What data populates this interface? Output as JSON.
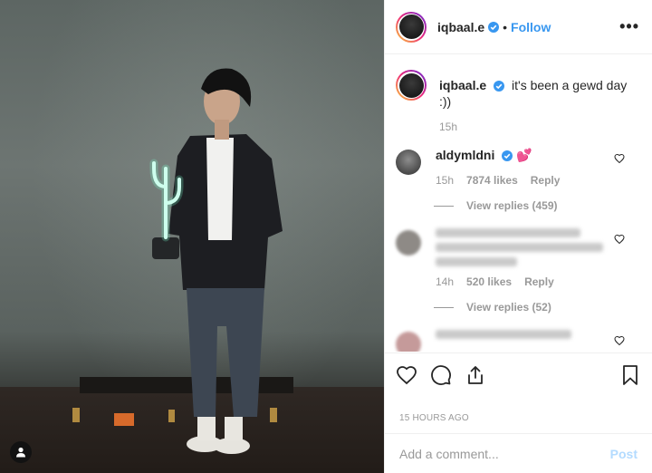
{
  "post": {
    "username": "iqbaal.e",
    "follow_label": "Follow",
    "more_label": "•••",
    "caption": "it's been a gewd day :))",
    "caption_time": "15h",
    "timestamp": "15 HOURS AGO"
  },
  "comments": [
    {
      "username": "aldymldni",
      "text": "💕",
      "time": "15h",
      "likes": "7874 likes",
      "reply_label": "Reply",
      "view_replies": "View replies (459)"
    },
    {
      "username": "",
      "text": "",
      "time": "14h",
      "likes": "520 likes",
      "reply_label": "Reply",
      "view_replies": "View replies (52)"
    }
  ],
  "add_comment": {
    "placeholder": "Add a comment...",
    "post_label": "Post"
  },
  "colors": {
    "link_blue": "#3897f0",
    "post_disabled": "#b3dbff",
    "verified_blue": "#3897f0"
  }
}
